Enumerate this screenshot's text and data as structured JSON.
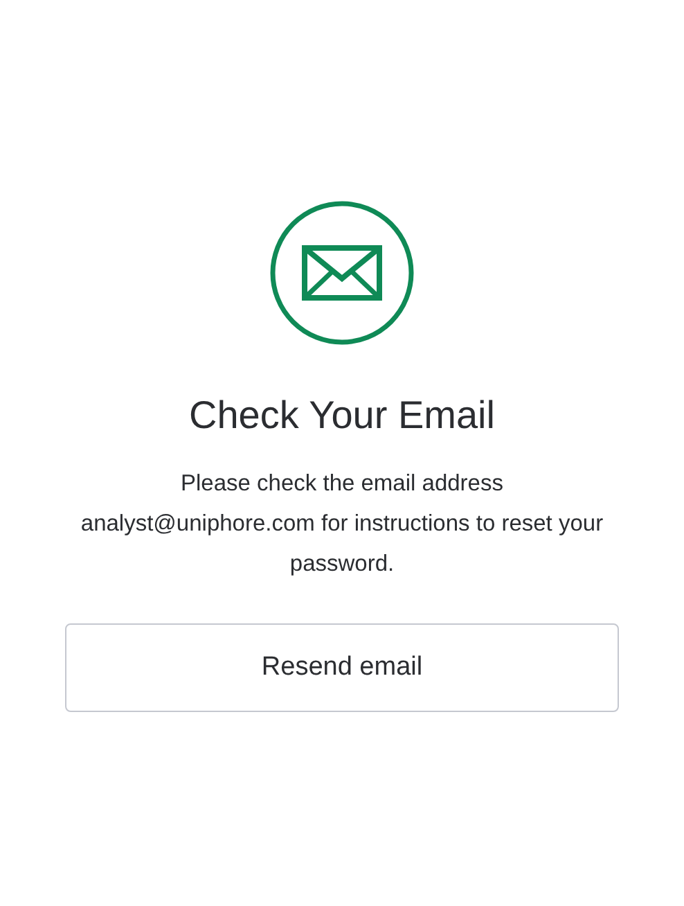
{
  "title": "Check Your Email",
  "message": "Please check the email address analyst@uniphore.com for instructions to reset your password.",
  "button": "Resend email"
}
